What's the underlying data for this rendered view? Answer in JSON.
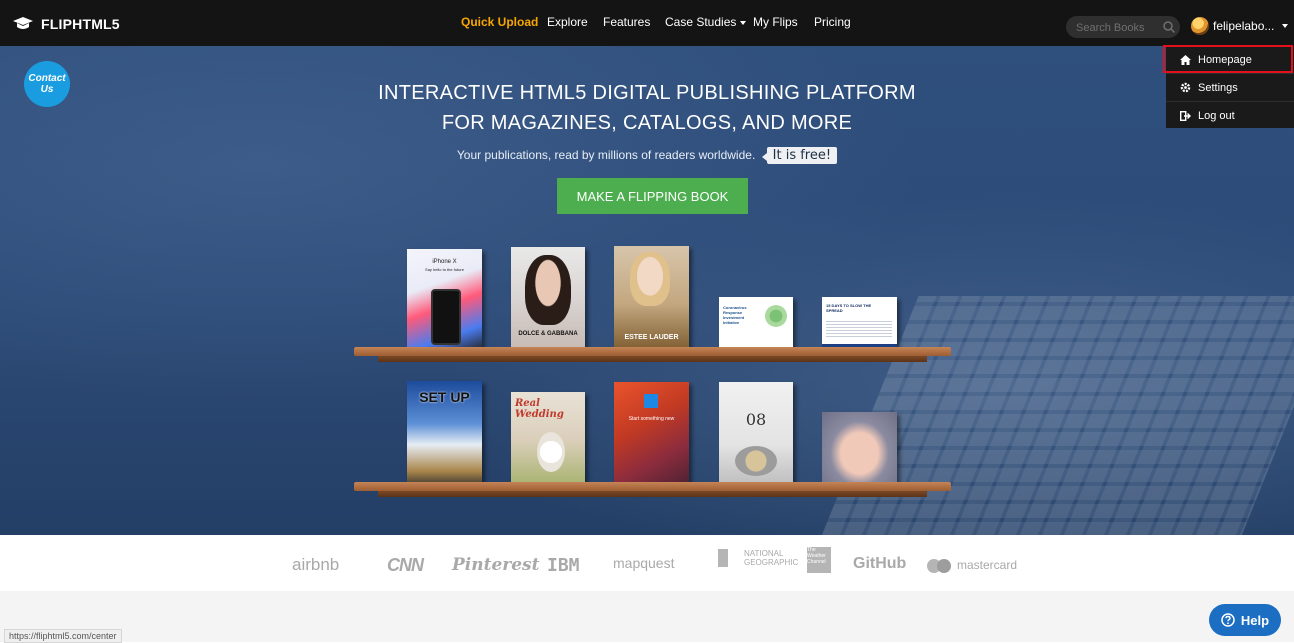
{
  "header": {
    "logo_text": "FLIPHTML5",
    "nav": [
      {
        "label": "Quick Upload",
        "active": true
      },
      {
        "label": "Explore"
      },
      {
        "label": "Features"
      },
      {
        "label": "Case Studies",
        "has_caret": true
      },
      {
        "label": "My Flips"
      },
      {
        "label": "Pricing"
      }
    ],
    "search_placeholder": "Search Books",
    "user_name": "felipelabo..."
  },
  "user_menu": {
    "items": [
      {
        "label": "Homepage",
        "icon": "home-icon",
        "highlighted": true
      },
      {
        "label": "Settings",
        "icon": "gear-icon"
      },
      {
        "label": "Log out",
        "icon": "logout-icon"
      }
    ]
  },
  "hero": {
    "contact_label": "Contact Us",
    "title_line1": "INTERACTIVE HTML5 DIGITAL PUBLISHING PLATFORM",
    "title_line2": "FOR MAGAZINES, CATALOGS, AND MORE",
    "subtitle": "Your publications, read by millions of readers worldwide.",
    "free_badge": "It is free!",
    "cta_label": "MAKE A FLIPPING BOOK"
  },
  "shelf_books": {
    "top": [
      {
        "title": "iPhone X",
        "subtitle": "Say hello to the future"
      },
      {
        "title": "DOLCE & GABBANA"
      },
      {
        "title": "ESTEE LAUDER"
      },
      {
        "title": "Coronavirus Response Investment Initiative"
      },
      {
        "title": "15 DAYS TO SLOW THE SPREAD"
      }
    ],
    "bottom": [
      {
        "title": "SET UP"
      },
      {
        "title": "Real Wedding"
      },
      {
        "title": "Start something new"
      },
      {
        "title": "08"
      },
      {
        "title": ""
      }
    ]
  },
  "brand_logos": [
    "airbnb",
    "CNN",
    "Pinterest",
    "IBM",
    "mapquest",
    "NATIONAL GEOGRAPHIC",
    "The Weather Channel",
    "GitHub",
    "mastercard"
  ],
  "status_bar_url": "https://fliphtml5.com/center",
  "help_label": "Help",
  "colors": {
    "topbar": "#141414",
    "active_nav": "#f7a600",
    "cta_green": "#4cae4f",
    "help_blue": "#1b6ec2",
    "highlight_red": "#e3101b"
  }
}
